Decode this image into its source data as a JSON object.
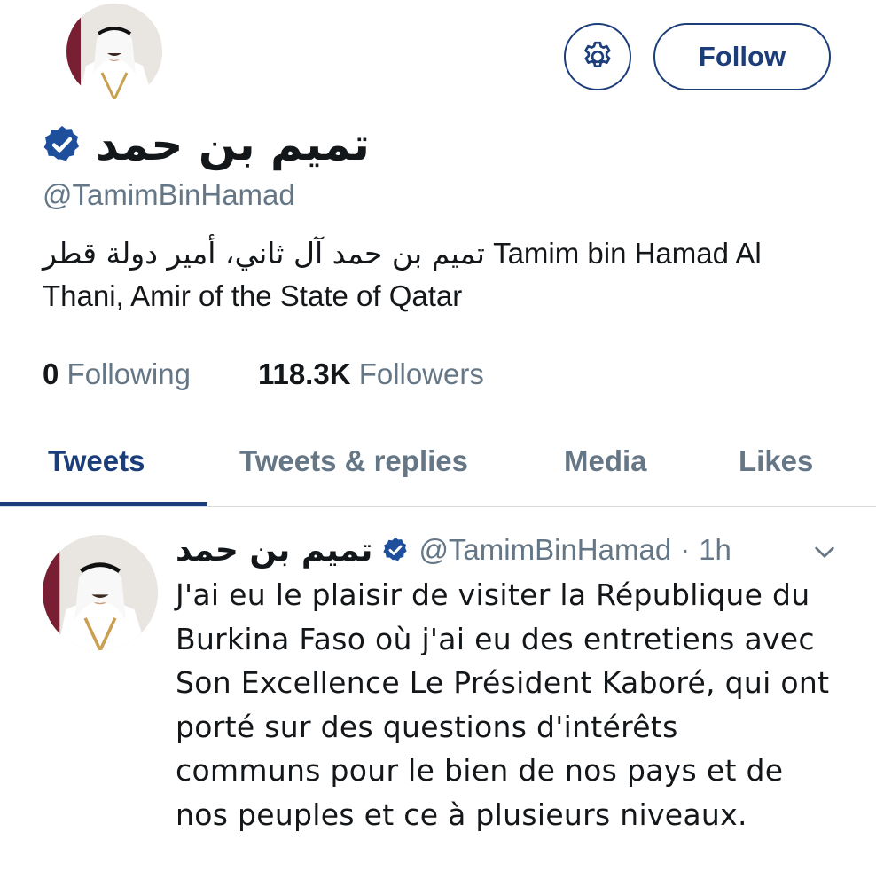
{
  "profile": {
    "display_name": "تميم بن حمد",
    "handle": "@TamimBinHamad",
    "bio_arabic": "تميم بن حمد آل ثاني، أمير دولة قطر",
    "bio_english": "Tamim bin Hamad Al Thani, Amir of the State of Qatar",
    "following_count": "0",
    "following_label": "Following",
    "followers_count": "118.3K",
    "followers_label": "Followers",
    "verified_icon": "verified-badge-icon"
  },
  "actions": {
    "settings_icon": "gear-icon",
    "follow_label": "Follow"
  },
  "tabs": [
    {
      "label": "Tweets",
      "active": true
    },
    {
      "label": "Tweets & replies",
      "active": false
    },
    {
      "label": "Media",
      "active": false
    },
    {
      "label": "Likes",
      "active": false
    }
  ],
  "tweet": {
    "name": "تميم بن حمد",
    "handle": "@TamimBinHamad",
    "separator": "·",
    "time": "1h",
    "text": "J'ai eu le plaisir de visiter la République du Burkina Faso où j'ai eu des entretiens avec Son Excellence Le Président Kaboré, qui ont porté sur des questions d'intérêts communs pour le bien de nos pays et de nos peuples et ce à plusieurs niveaux.",
    "menu_icon": "chevron-down-icon"
  },
  "colors": {
    "accent": "#1b3d7a",
    "verified": "#1d4f9c",
    "secondary_text": "#657786"
  }
}
